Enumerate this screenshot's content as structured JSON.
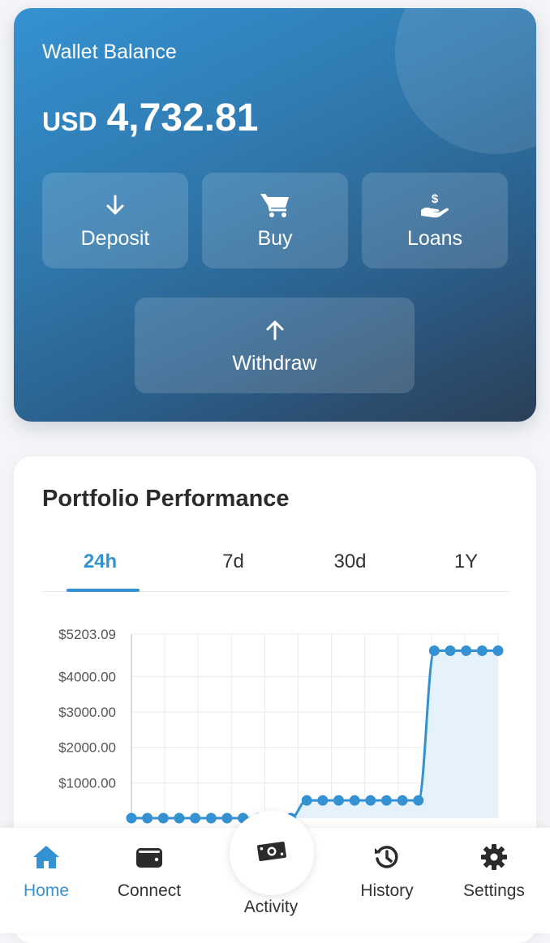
{
  "wallet": {
    "label": "Wallet Balance",
    "currency": "USD",
    "amount": "4,732.81",
    "actions": [
      {
        "label": "Deposit",
        "icon": "arrow-down-icon"
      },
      {
        "label": "Buy",
        "icon": "cart-icon"
      },
      {
        "label": "Loans",
        "icon": "hand-dollar-icon"
      },
      {
        "label": "Withdraw",
        "icon": "arrow-up-icon"
      }
    ]
  },
  "performance": {
    "title": "Portfolio Performance",
    "tabs": [
      {
        "label": "24h",
        "active": true
      },
      {
        "label": "7d",
        "active": false
      },
      {
        "label": "30d",
        "active": false
      },
      {
        "label": "1Y",
        "active": false
      }
    ]
  },
  "chart_data": {
    "type": "line",
    "series": [
      {
        "values": [
          0,
          0,
          0,
          0,
          0,
          0,
          0,
          0,
          0,
          0,
          0,
          500,
          500,
          500,
          500,
          500,
          500,
          500,
          500,
          4732.81,
          4732.81,
          4732.81,
          4732.81,
          4732.81
        ]
      }
    ],
    "y_ticks": [
      "$5203.09",
      "$4000.00",
      "$3000.00",
      "$2000.00",
      "$1000.00"
    ],
    "y_tick_values": [
      5203.09,
      4000,
      3000,
      2000,
      1000
    ],
    "ylim": [
      0,
      5203.09
    ],
    "grid": true,
    "line_color": "#3592d2",
    "fill_color": "#e6f2fb"
  },
  "nav": {
    "items": [
      {
        "label": "Home",
        "icon": "home-icon",
        "active": true
      },
      {
        "label": "Connect",
        "icon": "wallet-icon",
        "active": false
      },
      {
        "label": "History",
        "icon": "history-icon",
        "active": false
      },
      {
        "label": "Settings",
        "icon": "gear-icon",
        "active": false
      }
    ],
    "center": {
      "label": "Activity",
      "icon": "money-bill-icon"
    }
  },
  "colors": {
    "accent": "#3592d2",
    "card_gradient_start": "#3592d2",
    "card_gradient_end": "#2b3f57"
  }
}
